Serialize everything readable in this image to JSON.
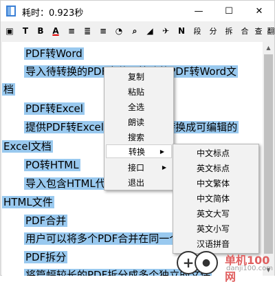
{
  "window": {
    "title": "耗时：0.923秒",
    "minimize": "—",
    "maximize": "☐",
    "close": "✕"
  },
  "toolbar": {
    "items": [
      {
        "label": "▣"
      },
      {
        "label": "T"
      },
      {
        "label": "B"
      },
      {
        "label": "A"
      },
      {
        "label": "≡"
      },
      {
        "label": "≣"
      },
      {
        "label": "≡"
      },
      {
        "label": "◔"
      },
      {
        "label": "⌕"
      },
      {
        "label": "◢"
      },
      {
        "label": "✈"
      },
      {
        "label": "N"
      },
      {
        "label": "段"
      },
      {
        "label": "分"
      },
      {
        "label": "拆"
      },
      {
        "label": "合"
      },
      {
        "label": "查"
      },
      {
        "label": "翻"
      }
    ]
  },
  "content": {
    "lines": [
      "PDF转Word",
      "导入待转换的PDF文件，快速将PDF转Word文",
      "档",
      "PDF转Excel",
      "提供PDF转Excel功能，将PDF转换成可编辑的",
      "Excel文档",
      "PO转HTML",
      "导入包含HTML代码的文件，转换为",
      "HTML文件",
      "PDF合并",
      "用户可以将多个PDF合并在同一个文件",
      "PDF拆分",
      "将篇幅较长的PDF拆分成多个独立的文件"
    ]
  },
  "context_menu": {
    "items": [
      "复制",
      "粘贴",
      "全选",
      "朗读",
      "搜索",
      "转换",
      "接口",
      "退出"
    ]
  },
  "submenu": {
    "items": [
      "中文标点",
      "英文标点",
      "中文繁体",
      "中文简体",
      "英文大写",
      "英文小写",
      "汉语拼音"
    ]
  },
  "watermark": {
    "symbol": "+",
    "brand": "单机100网",
    "site": "danji100.com"
  }
}
